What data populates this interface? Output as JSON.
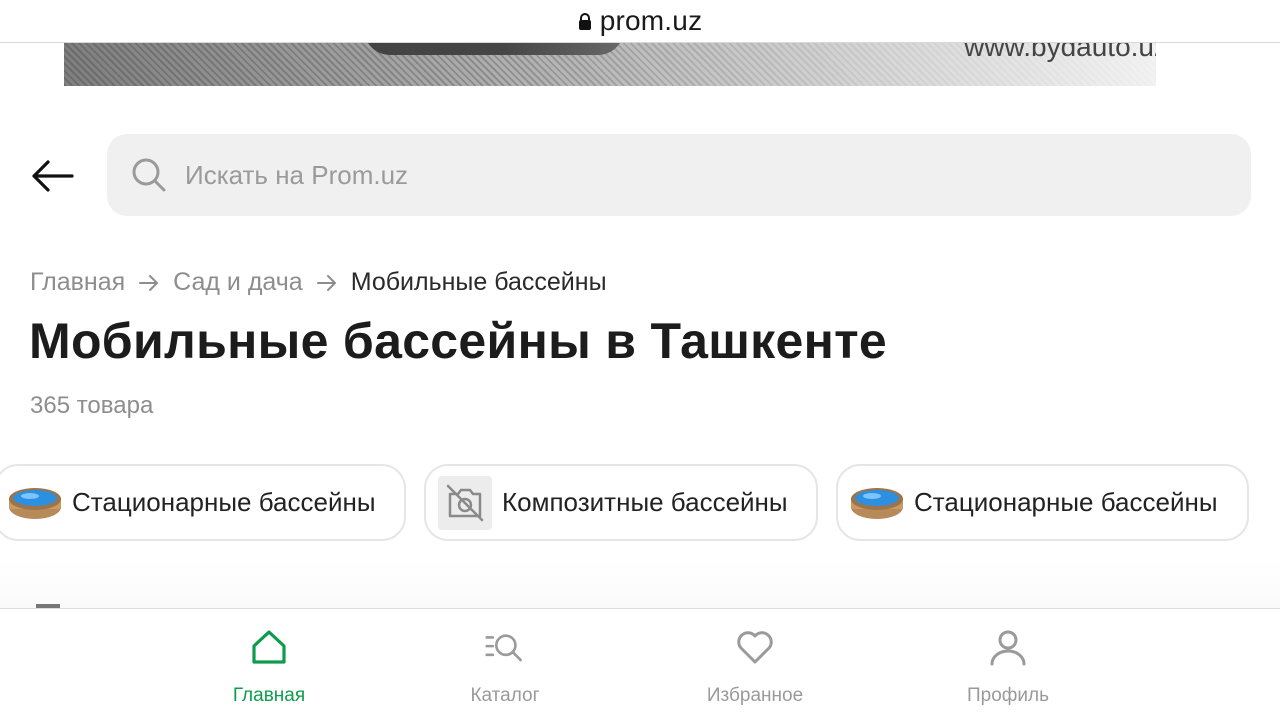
{
  "browser": {
    "url": "prom.uz"
  },
  "banner": {
    "site_text": "www.bydauto.uz"
  },
  "search": {
    "placeholder": "Искать на Prom.uz"
  },
  "breadcrumbs": {
    "home": "Главная",
    "category": "Сад и дача",
    "current": "Мобильные бассейны"
  },
  "page": {
    "title": "Мобильные бассейны в Ташкенте",
    "count": "365 товара"
  },
  "chips": [
    {
      "label": "Стационарные бассейны",
      "thumb": "pool-image"
    },
    {
      "label": "Композитные бассейны",
      "thumb": "no-image-icon"
    },
    {
      "label": "Стационарные бассейны",
      "thumb": "pool-image"
    }
  ],
  "nav": {
    "home": "Главная",
    "catalog": "Каталог",
    "favorites": "Избранное",
    "profile": "Профиль"
  },
  "colors": {
    "accent": "#0e9c4c",
    "search_bg": "#f0f0f0",
    "muted_text": "#8d8d8d"
  }
}
